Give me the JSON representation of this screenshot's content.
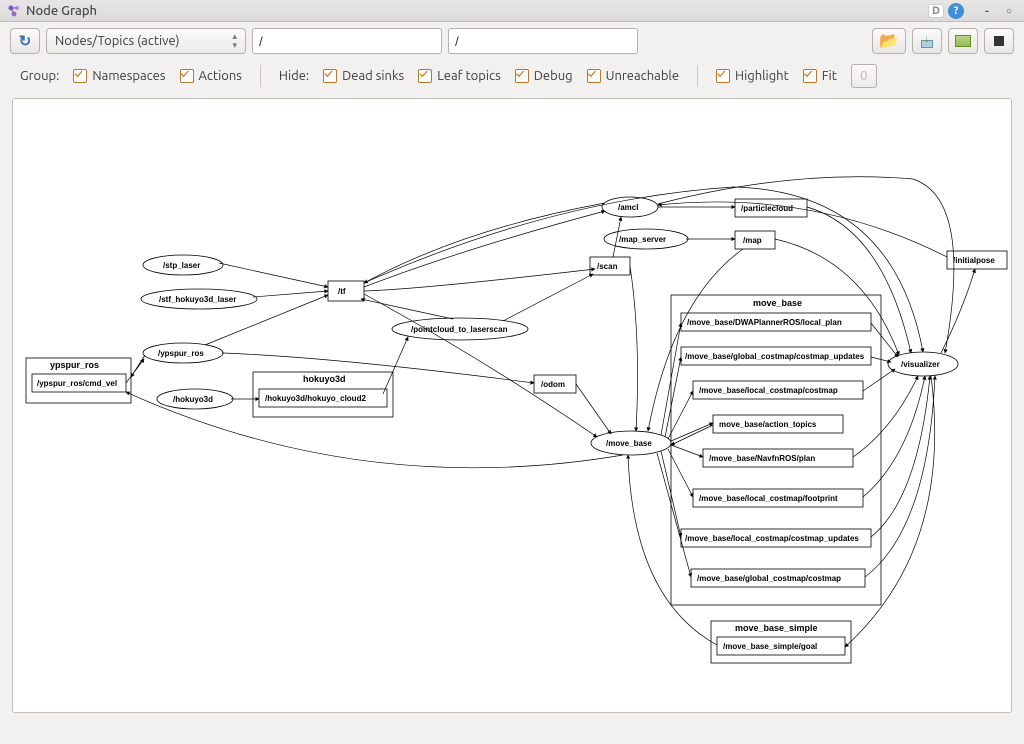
{
  "title": "Node Graph",
  "toolbar": {
    "dropdown_label": "Nodes/Topics (active)",
    "filter1": "/",
    "filter2": "/"
  },
  "options": {
    "group_label": "Group:",
    "namespaces": "Namespaces",
    "actions": "Actions",
    "hide_label": "Hide:",
    "dead_sinks": "Dead sinks",
    "leaf_topics": "Leaf topics",
    "debug": "Debug",
    "unreachable": "Unreachable",
    "highlight": "Highlight",
    "fit": "Fit",
    "zoom_level": "0"
  },
  "graph": {
    "groups": {
      "ypspur_ros": "ypspur_ros",
      "hokuyo3d": "hokuyo3d",
      "move_base": "move_base",
      "move_base_simple": "move_base_simple"
    },
    "nodes": {
      "stp_laser": "/stp_laser",
      "stf_hokuyo3d_laser": "/stf_hokuyo3d_laser",
      "ypspur_ros_node": "/ypspur_ros",
      "ypspur_cmd_vel": "/ypspur_ros/cmd_vel",
      "hokuyo3d_node": "/hokuyo3d",
      "hokuyo_cloud2": "/hokuyo3d/hokuyo_cloud2",
      "tf": "/tf",
      "pointcloud_to_laserscan": "/pointcloud_to_laserscan",
      "odom": "/odom",
      "scan": "/scan",
      "amcl": "/amcl",
      "map_server": "/map_server",
      "particlecloud": "/particlecloud",
      "map": "/map",
      "move_base_node": "/move_base",
      "dwa_local_plan": "/move_base/DWAPlannerROS/local_plan",
      "global_updates": "/move_base/global_costmap/costmap_updates",
      "local_costmap": "/move_base/local_costmap/costmap",
      "action_topics": "move_base/action_topics",
      "navfn_plan": "/move_base/NavfnROS/plan",
      "local_footprint": "/move_base/local_costmap/footprint",
      "local_updates": "/move_base/local_costmap/costmap_updates",
      "global_costmap": "/move_base/global_costmap/costmap",
      "mbs_goal": "/move_base_simple/goal",
      "visualizer": "/visualizer",
      "initialpose": "/initialpose"
    }
  }
}
